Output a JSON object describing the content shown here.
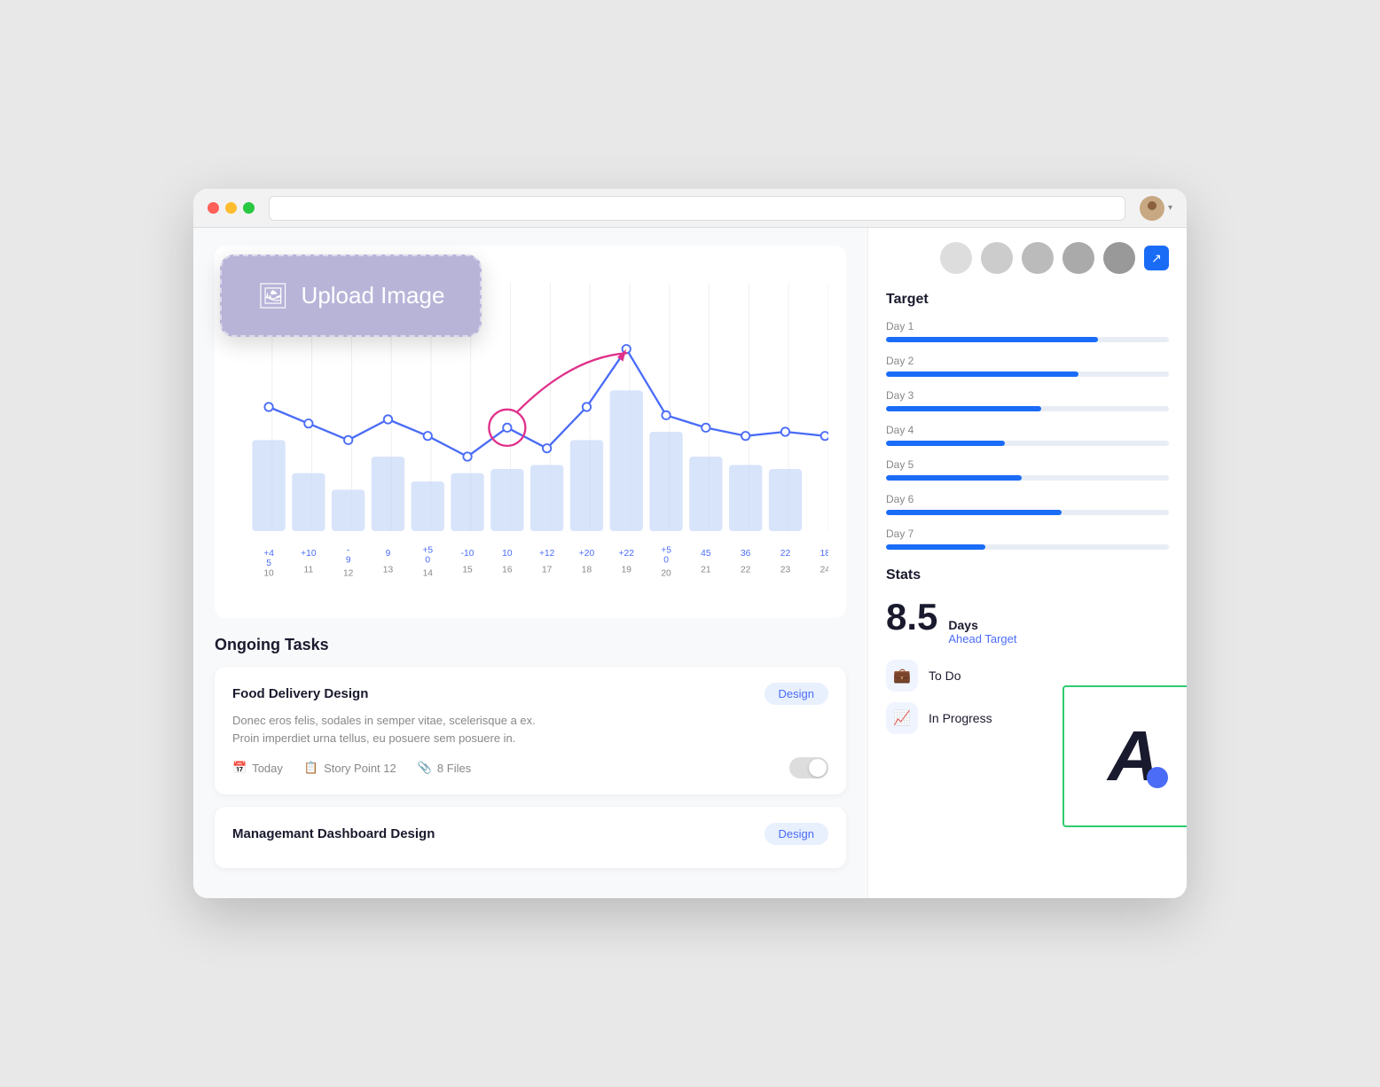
{
  "browser": {
    "avatar_label": "User Avatar"
  },
  "upload": {
    "label": "Upload Image",
    "icon": "🖼"
  },
  "chart": {
    "x_labels": [
      "10",
      "11",
      "12",
      "13",
      "14",
      "15",
      "16",
      "17",
      "18",
      "19",
      "20",
      "21",
      "22",
      "23",
      "24"
    ],
    "x_deltas": [
      "+4\n5",
      "+10",
      "-\n9",
      "9",
      "+5\n0",
      "-10",
      "10",
      "+12",
      "+20",
      "+22",
      "+5\n0",
      "45",
      "36",
      "22",
      "18"
    ]
  },
  "target": {
    "title": "Target",
    "days": [
      {
        "label": "Day 1",
        "percent": 75
      },
      {
        "label": "Day 2",
        "percent": 68
      },
      {
        "label": "Day 3",
        "percent": 55
      },
      {
        "label": "Day 4",
        "percent": 42
      },
      {
        "label": "Day 5",
        "percent": 48
      },
      {
        "label": "Day 6",
        "percent": 62
      },
      {
        "label": "Day 7",
        "percent": 35
      }
    ]
  },
  "stats": {
    "title": "Stats",
    "big_number": "8.5",
    "big_label": "Days",
    "big_sublabel": "Ahead Target",
    "items": [
      {
        "icon": "💼",
        "label": "To Do",
        "count": ""
      },
      {
        "icon": "📈",
        "label": "In Progress",
        "count": ""
      }
    ]
  },
  "tasks": {
    "section_title": "Ongoing Tasks",
    "items": [
      {
        "title": "Food Delivery Design",
        "badge": "Design",
        "desc_line1": "Donec eros felis, sodales in semper vitae, scelerisque a ex.",
        "desc_line2": "Proin imperdiet urna tellus, eu posuere sem posuere in.",
        "date": "Today",
        "story_point": "Story Point 12",
        "files": "8 Files"
      },
      {
        "title": "Managemant Dashboard Design",
        "badge": "Design",
        "desc_line1": "",
        "desc_line2": "",
        "date": "",
        "story_point": "",
        "files": ""
      }
    ]
  }
}
